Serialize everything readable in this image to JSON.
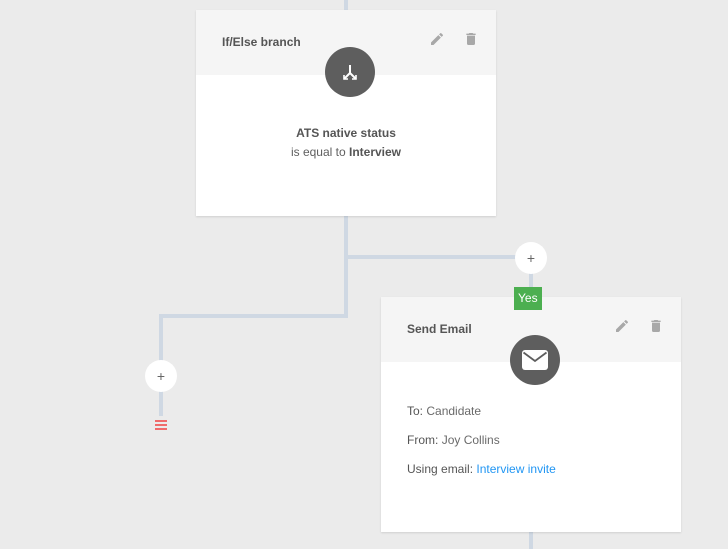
{
  "workflow": {
    "branch_card": {
      "title": "If/Else branch",
      "node_icon": "branch-split-icon",
      "edit_icon": "pencil-icon",
      "delete_icon": "trash-icon",
      "condition_field": "ATS native status",
      "condition_operator": "is equal to",
      "condition_value": "Interview"
    },
    "yes_badge": "Yes",
    "add_step_label": "+",
    "email_card": {
      "title": "Send Email",
      "node_icon": "envelope-icon",
      "edit_icon": "pencil-icon",
      "delete_icon": "trash-icon",
      "to_label": "To:",
      "to_value": "Candidate",
      "from_label": "From:",
      "from_value": "Joy Collins",
      "using_label": "Using email:",
      "using_value": "Interview invite"
    },
    "end_marker_icon": "end-flow-icon",
    "colors": {
      "connector": "#cfd8e3",
      "yes_badge": "#4caf50",
      "link": "#2196f3",
      "node_icon_bg": "#5e5e5e",
      "end_marker": "#ef6b6b"
    }
  }
}
